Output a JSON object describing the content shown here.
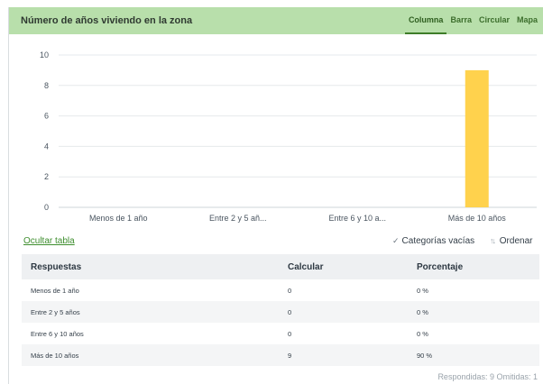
{
  "header": {
    "title": "Número de años viviendo en la zona"
  },
  "tabs": [
    {
      "label": "Columna",
      "active": true
    },
    {
      "label": "Barra",
      "active": false
    },
    {
      "label": "Circular",
      "active": false
    },
    {
      "label": "Mapa",
      "active": false
    }
  ],
  "chart_data": {
    "type": "bar",
    "categories": [
      "Menos de 1 año",
      "Entre 2 y 5 añ...",
      "Entre 6 y 10 a...",
      "Más de 10 años"
    ],
    "values": [
      0,
      0,
      0,
      9
    ],
    "ylim": [
      0,
      10
    ],
    "yticks": [
      0,
      2,
      4,
      6,
      8,
      10
    ],
    "grid": true,
    "bar_color": "#ffd24d"
  },
  "toolbar": {
    "hide_table": "Ocultar tabla",
    "empty_categories": "Categorías vacías",
    "sort": "Ordenar"
  },
  "table": {
    "headers": [
      "Respuestas",
      "Calcular",
      "Porcentaje"
    ],
    "rows": [
      [
        "Menos de 1 año",
        "0",
        "0 %"
      ],
      [
        "Entre 2 y 5 años",
        "0",
        "0 %"
      ],
      [
        "Entre 6 y 10 años",
        "0",
        "0 %"
      ],
      [
        "Más de 10 años",
        "9",
        "90 %"
      ]
    ]
  },
  "footer": {
    "summary": "Respondidas: 9  Omitidas: 1"
  }
}
